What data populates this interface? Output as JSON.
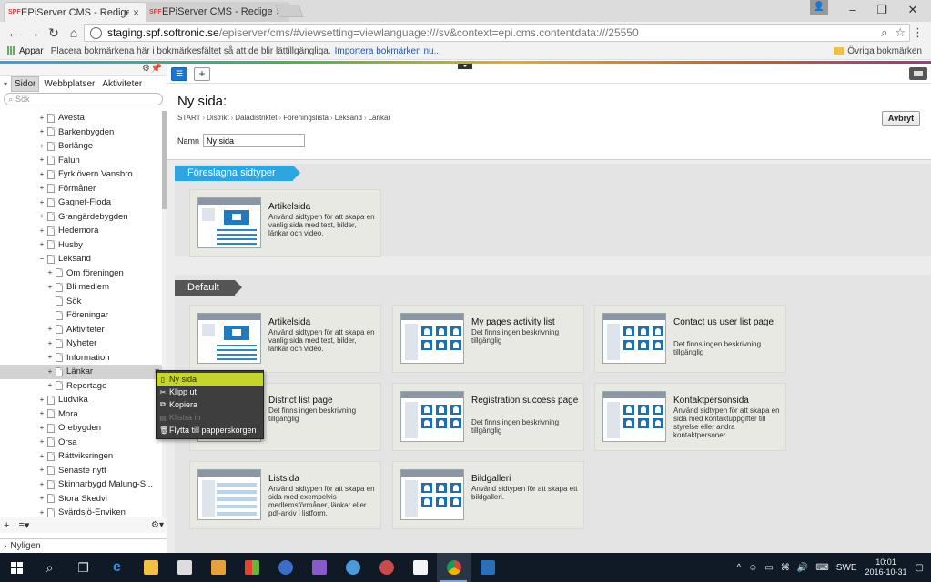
{
  "browser": {
    "tabs": [
      {
        "favicon": "SPF",
        "title": "EPiServer CMS - Redigera",
        "active": true
      },
      {
        "favicon": "SPF",
        "title": "EPiServer CMS - Redigera",
        "active": false
      }
    ],
    "url_host": "staging.spf.softronic.se",
    "url_path": "/episerver/cms/#viewsetting=viewlanguage:///sv&context=epi.cms.contentdata:///25550",
    "bookmarks": {
      "apps": "Appar",
      "hint": "Placera bokmärkena här i bokmärkesfältet så att de blir lättillgängliga.",
      "import": "Importera bokmärken nu...",
      "other": "Övriga bokmärken"
    }
  },
  "nav": {
    "tabs": [
      "Sidor",
      "Webbplatser",
      "Aktiviteter"
    ],
    "active_tab": "Sidor",
    "search_placeholder": "Sök",
    "tree": [
      {
        "label": "Avesta",
        "indent": 0,
        "expand": "+"
      },
      {
        "label": "Barkenbygden",
        "indent": 0,
        "expand": "+"
      },
      {
        "label": "Borlänge",
        "indent": 0,
        "expand": "+"
      },
      {
        "label": "Falun",
        "indent": 0,
        "expand": "+"
      },
      {
        "label": "Fyrklövern Vansbro",
        "indent": 0,
        "expand": "+"
      },
      {
        "label": "Förmåner",
        "indent": 0,
        "expand": "+"
      },
      {
        "label": "Gagnef-Floda",
        "indent": 0,
        "expand": "+"
      },
      {
        "label": "Grangärdebygden",
        "indent": 0,
        "expand": "+"
      },
      {
        "label": "Hedemora",
        "indent": 0,
        "expand": "+"
      },
      {
        "label": "Husby",
        "indent": 0,
        "expand": "+"
      },
      {
        "label": "Leksand",
        "indent": 0,
        "expand": "−"
      },
      {
        "label": "Om föreningen",
        "indent": 1,
        "expand": "+"
      },
      {
        "label": "Bli medlem",
        "indent": 1,
        "expand": "+"
      },
      {
        "label": "Sök",
        "indent": 1,
        "expand": ""
      },
      {
        "label": "Föreningar",
        "indent": 1,
        "expand": ""
      },
      {
        "label": "Aktiviteter",
        "indent": 1,
        "expand": "+"
      },
      {
        "label": "Nyheter",
        "indent": 1,
        "expand": "+"
      },
      {
        "label": "Information",
        "indent": 1,
        "expand": "+"
      },
      {
        "label": "Länkar",
        "indent": 1,
        "expand": "+",
        "selected": true
      },
      {
        "label": "Reportage",
        "indent": 1,
        "expand": "+"
      },
      {
        "label": "Ludvika",
        "indent": 0,
        "expand": "+"
      },
      {
        "label": "Mora",
        "indent": 0,
        "expand": "+"
      },
      {
        "label": "Orebygden",
        "indent": 0,
        "expand": "+"
      },
      {
        "label": "Orsa",
        "indent": 0,
        "expand": "+"
      },
      {
        "label": "Rättviksringen",
        "indent": 0,
        "expand": "+"
      },
      {
        "label": "Senaste nytt",
        "indent": 0,
        "expand": "+"
      },
      {
        "label": "Skinnarbygd Malung-S...",
        "indent": 0,
        "expand": "+"
      },
      {
        "label": "Stora Skedvi",
        "indent": 0,
        "expand": "+"
      },
      {
        "label": "Svärdsjö-Enviken",
        "indent": 0,
        "expand": "+"
      }
    ],
    "recent": "Nyligen"
  },
  "context_menu": [
    {
      "label": "Ny sida",
      "icon": "page-icon",
      "highlighted": true,
      "disabled": false
    },
    {
      "label": "Klipp ut",
      "icon": "scissors-icon",
      "highlighted": false,
      "disabled": false
    },
    {
      "label": "Kopiera",
      "icon": "copy-icon",
      "highlighted": false,
      "disabled": false
    },
    {
      "label": "Klistra in",
      "icon": "paste-icon",
      "highlighted": false,
      "disabled": true
    },
    {
      "label": "Flytta till papperskorgen",
      "icon": "trash-icon",
      "highlighted": false,
      "disabled": false
    }
  ],
  "main": {
    "title": "Ny sida:",
    "breadcrumb": [
      "START",
      "Distrikt",
      "Daladistriktet",
      "Föreningslista",
      "Leksand",
      "Länkar"
    ],
    "name_label": "Namn",
    "name_value": "Ny sida",
    "cancel_label": "Avbryt",
    "suggested_label": "Föreslagna sidtyper",
    "default_label": "Default",
    "suggested": [
      {
        "title": "Artikelsida",
        "desc": "Använd sidtypen för att skapa en vanlig sida med text, bilder, länkar och video.",
        "thumb": "article"
      }
    ],
    "default_types": [
      {
        "title": "Artikelsida",
        "desc": "Använd sidtypen för att skapa en vanlig sida med text, bilder, länkar och video.",
        "thumb": "article"
      },
      {
        "title": "My pages activity list",
        "desc": "Det finns ingen beskrivning tillgänglig",
        "thumb": "grid"
      },
      {
        "title": "Contact us user list page",
        "desc": "Det finns ingen beskrivning tillgänglig",
        "thumb": "grid"
      },
      {
        "title": "District list page",
        "desc": "Det finns ingen beskrivning tillgänglig",
        "thumb": "list"
      },
      {
        "title": "Registration success page",
        "desc": "Det finns ingen beskrivning tillgänglig",
        "thumb": "grid"
      },
      {
        "title": "Kontaktpersonsida",
        "desc": "Använd sidtypen för att skapa en sida med kontaktuppgifter till styrelse eller andra kontaktpersoner.",
        "thumb": "grid"
      },
      {
        "title": "Listsida",
        "desc": "Använd sidtypen för att skapa en sida med exempelvis medlemsförmåner, länkar eller pdf-arkiv i listform.",
        "thumb": "list"
      },
      {
        "title": "Bildgalleri",
        "desc": "Använd sidtypen för att skapa ett bildgalleri.",
        "thumb": "grid"
      }
    ]
  },
  "taskbar": {
    "lang": "SWE",
    "time": "10:01",
    "date": "2016-10-31"
  },
  "colors": {
    "accent_blue": "#2fa5e0",
    "menu_highlight": "#c6d52a",
    "dark_tag": "#555555"
  }
}
